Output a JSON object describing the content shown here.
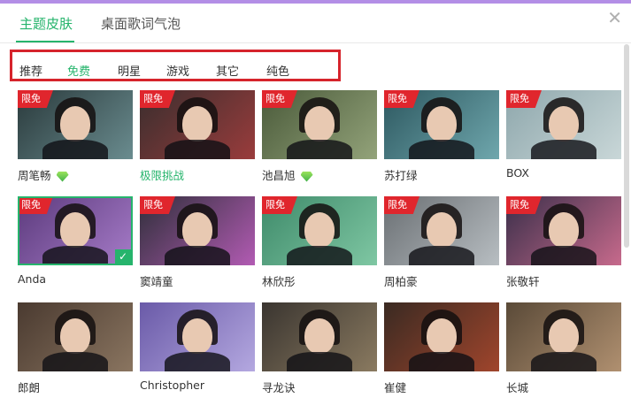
{
  "tabs": [
    {
      "label": "主题皮肤",
      "active": true
    },
    {
      "label": "桌面歌词气泡",
      "active": false
    }
  ],
  "filters": [
    "推荐",
    "免费",
    "明星",
    "游戏",
    "其它",
    "纯色"
  ],
  "active_filter": "免费",
  "badge_label": "限免",
  "skins": [
    {
      "name": "周笔畅",
      "vip": true,
      "bg": "#2a3a3c",
      "accent": "#6a8c8f"
    },
    {
      "name": "极限挑战",
      "highlight": true,
      "bg": "#3a2e2e",
      "accent": "#9a3c3c"
    },
    {
      "name": "池昌旭",
      "vip": true,
      "bg": "#4a5a3a",
      "accent": "#93a37a"
    },
    {
      "name": "苏打绿",
      "bg": "#2d5860",
      "accent": "#6fa7ad"
    },
    {
      "name": "BOX",
      "bg": "#8ea7ac",
      "accent": "#c9d7d8"
    },
    {
      "name": "Anda",
      "selected": true,
      "bg": "#5b3a7c",
      "accent": "#a77cc9"
    },
    {
      "name": "窦靖童",
      "bg": "#2f2f3a",
      "accent": "#b25bb3"
    },
    {
      "name": "林欣彤",
      "bg": "#3e8a6a",
      "accent": "#7fc7a3"
    },
    {
      "name": "周柏豪",
      "bg": "#6a6f73",
      "accent": "#b8bec2"
    },
    {
      "name": "张敬轩",
      "bg": "#3a2f4a",
      "accent": "#c76a8c"
    },
    {
      "name": "郎朗",
      "bg": "#4a3a30",
      "accent": "#8a7560"
    },
    {
      "name": "Christopher",
      "bg": "#6a5aa8",
      "accent": "#b4a8e0"
    },
    {
      "name": "寻龙诀",
      "bg": "#3a3530",
      "accent": "#8a7a60"
    },
    {
      "name": "崔健",
      "bg": "#3a2a22",
      "accent": "#a0452c"
    },
    {
      "name": "长城",
      "bg": "#5a4a38",
      "accent": "#b09070"
    }
  ]
}
